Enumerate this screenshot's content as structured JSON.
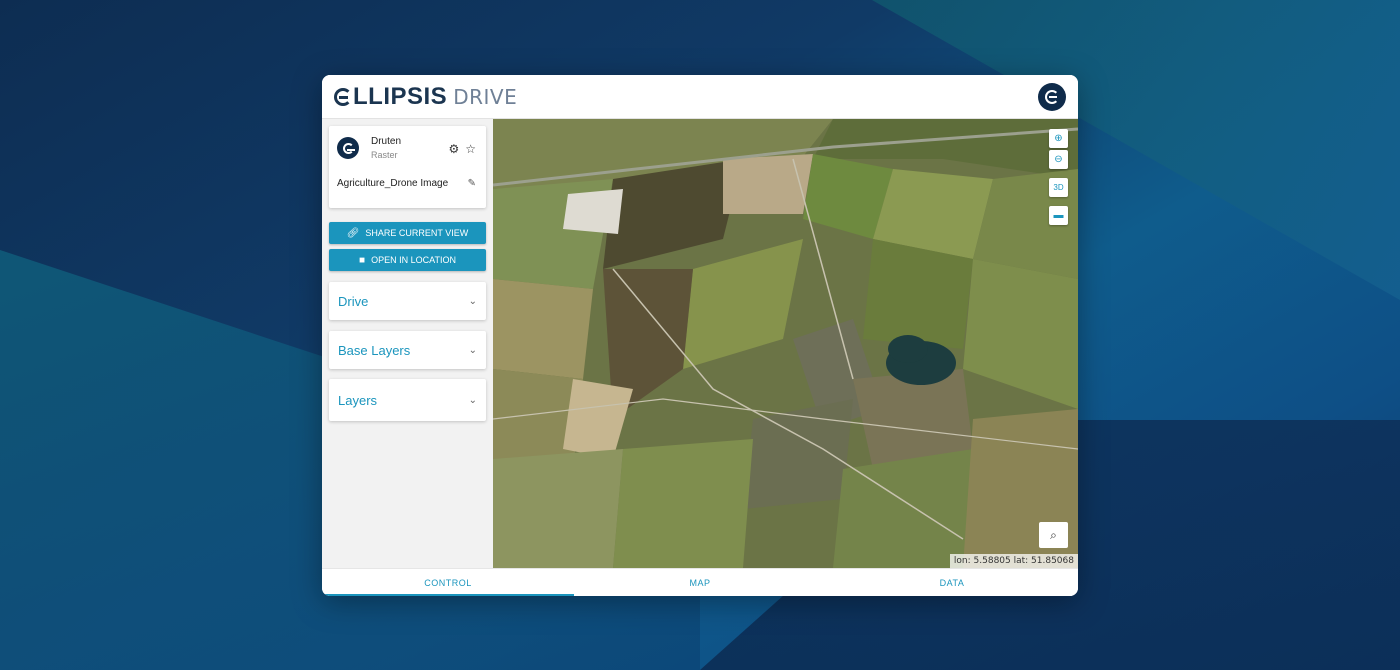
{
  "brand": {
    "name_bold": "LLIPSIS",
    "name_light": "DRIVE"
  },
  "map_card": {
    "title": "Druten",
    "subtitle": "Raster",
    "layer_name": "Agriculture_Drone Image"
  },
  "actions": {
    "share": "SHARE CURRENT VIEW",
    "open": "OPEN IN LOCATION"
  },
  "sections": [
    {
      "label": "Drive"
    },
    {
      "label": "Base Layers"
    },
    {
      "label": "Layers"
    }
  ],
  "map": {
    "coords": "lon: 5.58805 lat: 51.85068"
  },
  "tabs": [
    {
      "label": "CONTROL"
    },
    {
      "label": "MAP"
    },
    {
      "label": "DATA"
    }
  ],
  "colors": {
    "accent": "#1b95bd",
    "navy": "#0f2b4a"
  }
}
